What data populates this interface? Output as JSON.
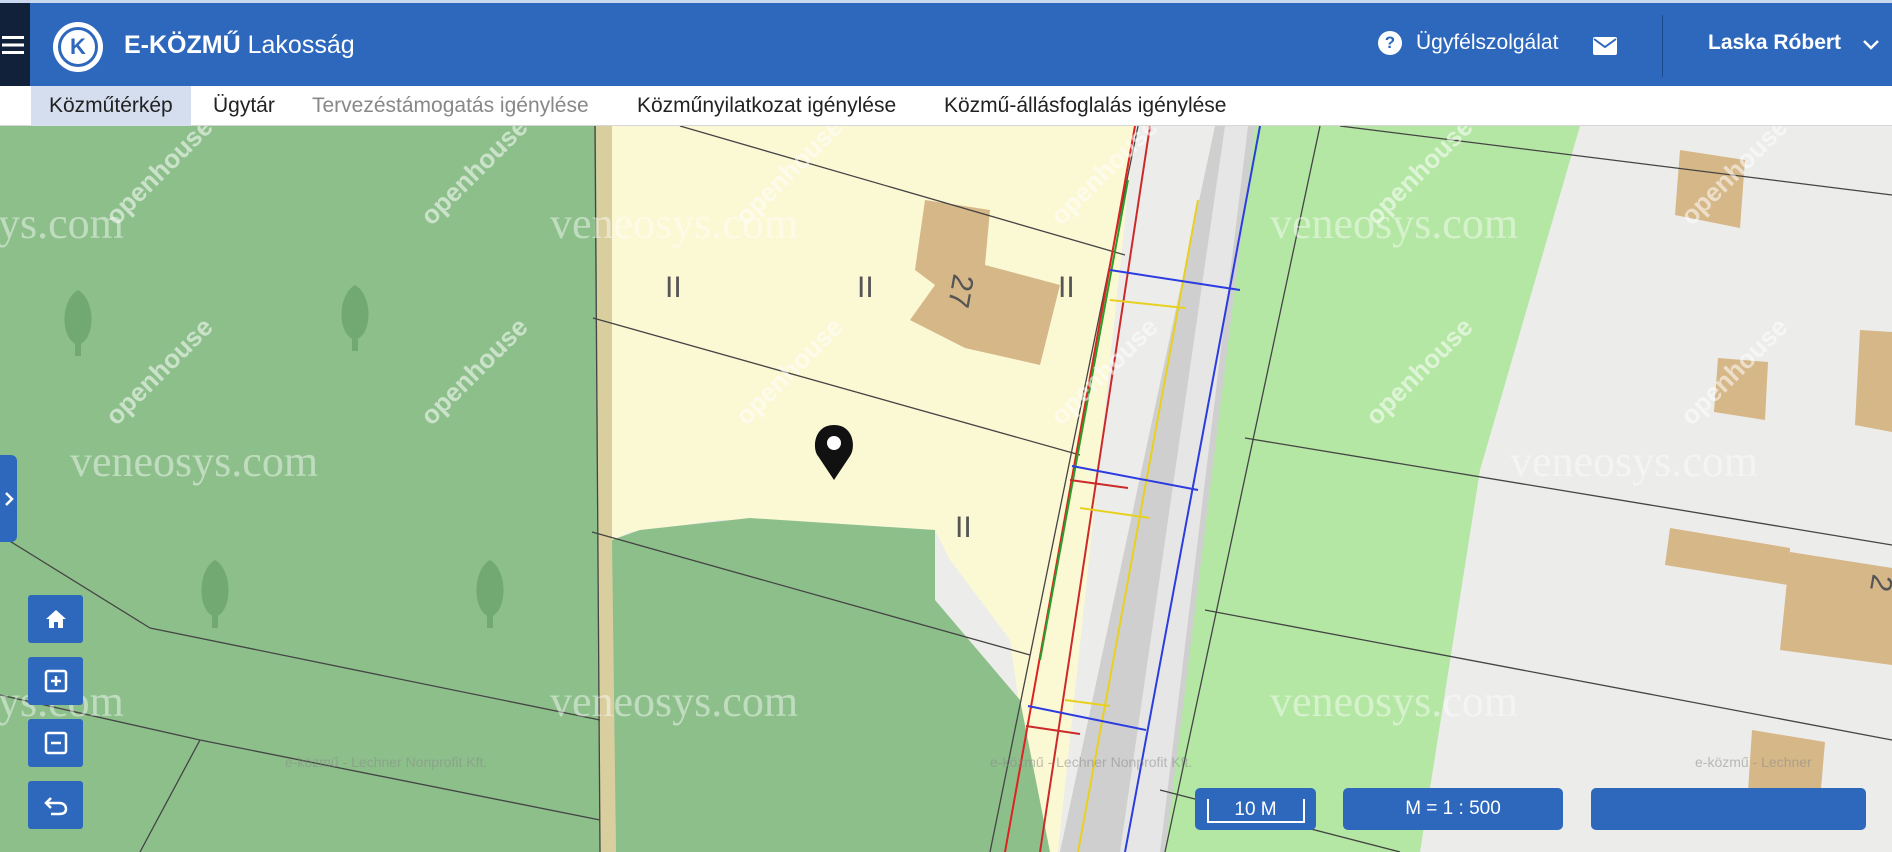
{
  "header": {
    "brand_bold": "E-KÖZMŰ",
    "brand_sub": "Lakosság",
    "logo_letter": "K",
    "help_label": "Ügyfélszolgálat",
    "user_name": "Laska Róbert"
  },
  "nav": {
    "tabs": [
      {
        "label": "Közműtérkép",
        "active": true
      },
      {
        "label": "Ügytár"
      },
      {
        "label": "Tervezéstámogatás igénylése",
        "disabled": true
      },
      {
        "label": "Közműnyilatkozat igénylése"
      },
      {
        "label": "Közmű-állásfoglalás igénylése"
      }
    ]
  },
  "map": {
    "house_number": "27",
    "partial_house_number": "2",
    "parcel_marks": [
      "II",
      "II",
      "II",
      "II"
    ],
    "watermark_text": "veneosys.com",
    "watermark_partial": "ys.com",
    "watermark_logo": "openhouse",
    "attribution": "e-közmű - Lechner Nonprofit Kft.",
    "attribution_partial": "e-közmű - Lechner"
  },
  "controls": {
    "scale_bar_label": "10 M",
    "scale_ratio_label": "M = 1 : 500"
  },
  "icons": {
    "menu": "hamburger-icon",
    "help": "question-circle-icon",
    "mail": "mail-icon",
    "chevron": "chevron-down-icon",
    "expand": "chevron-right-icon",
    "home": "home-icon",
    "zoom_in": "zoom-in-icon",
    "zoom_out": "zoom-out-icon",
    "back": "undo-icon",
    "marker": "map-marker-icon"
  },
  "colors": {
    "primary": "#2e68bd",
    "forest": "#8dbf8b",
    "parcel_yellow": "#fbf8d4",
    "light_green": "#b4e7a4",
    "building": "#d6b787"
  }
}
